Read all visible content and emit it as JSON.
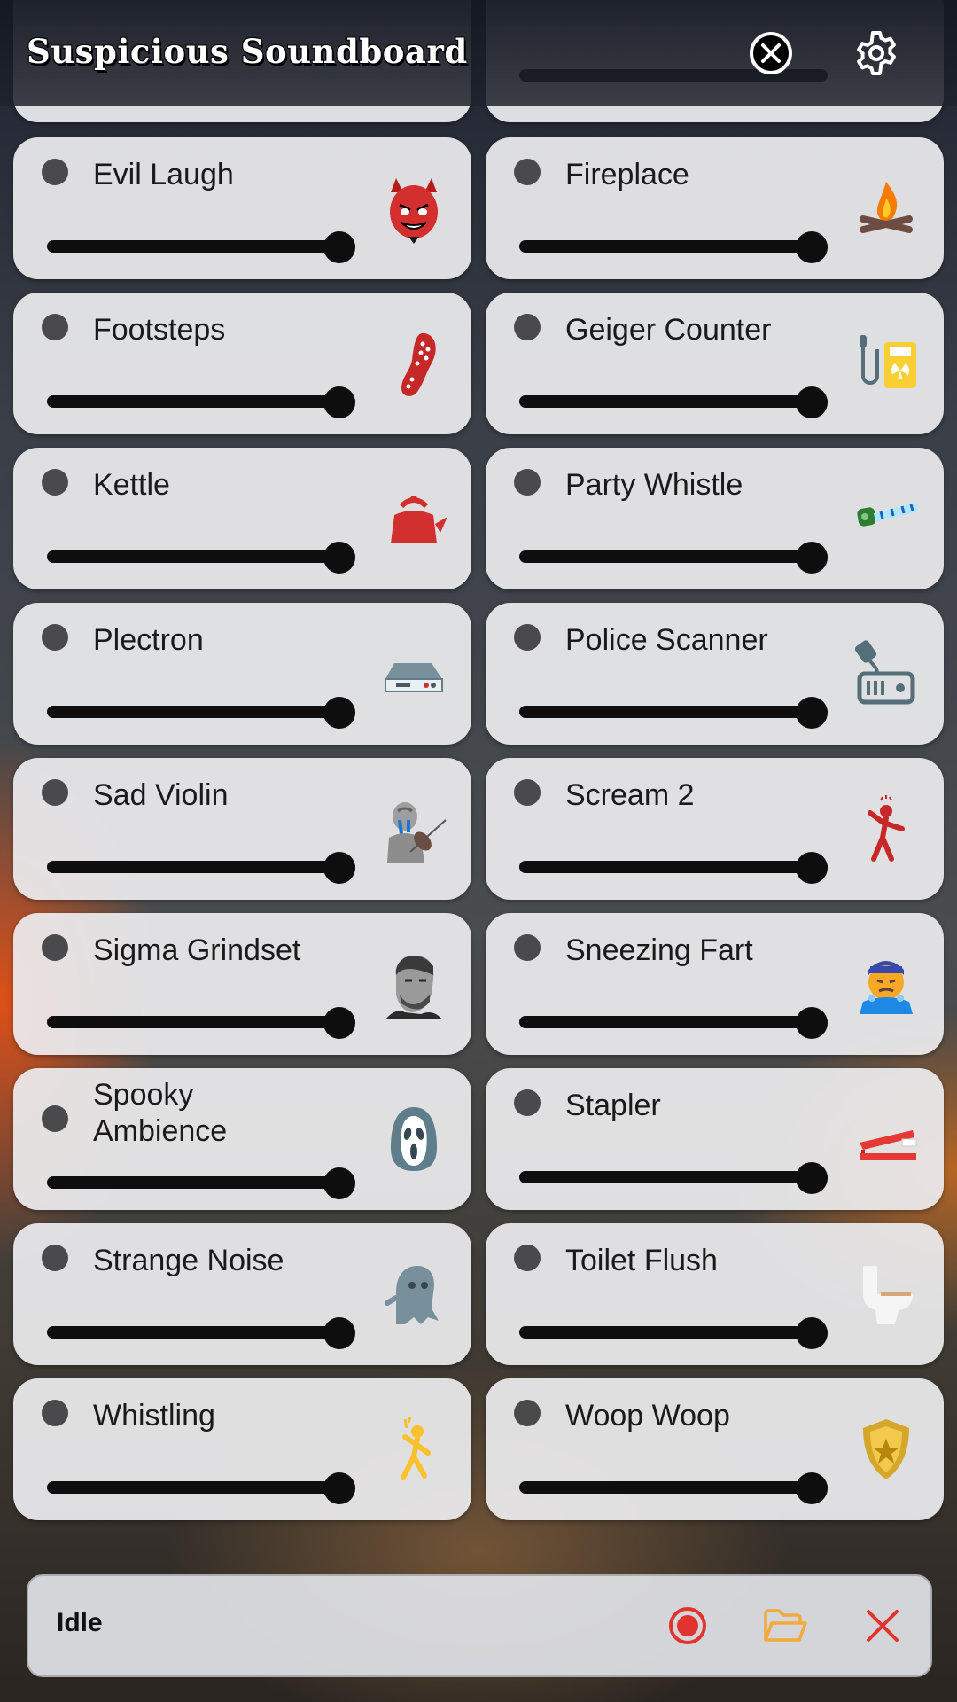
{
  "app": {
    "title": "Suspicious Soundboard",
    "close_icon": "close-circle-icon",
    "settings_icon": "gear-icon"
  },
  "sounds": [
    {
      "label": "Evil Laugh",
      "icon": "devil-icon",
      "volume": 1.0
    },
    {
      "label": "Fireplace",
      "icon": "campfire-icon",
      "volume": 1.0
    },
    {
      "label": "Footsteps",
      "icon": "shoe-sole-icon",
      "volume": 1.0
    },
    {
      "label": "Geiger Counter",
      "icon": "geiger-counter-icon",
      "volume": 1.0
    },
    {
      "label": "Kettle",
      "icon": "kettle-icon",
      "volume": 1.0
    },
    {
      "label": "Party Whistle",
      "icon": "party-blower-icon",
      "volume": 1.0
    },
    {
      "label": "Plectron",
      "icon": "radio-receiver-icon",
      "volume": 1.0
    },
    {
      "label": "Police Scanner",
      "icon": "police-scanner-icon",
      "volume": 1.0
    },
    {
      "label": "Sad Violin",
      "icon": "violinist-icon",
      "volume": 1.0
    },
    {
      "label": "Scream 2",
      "icon": "screaming-person-icon",
      "volume": 1.0
    },
    {
      "label": "Sigma Grindset",
      "icon": "chad-face-icon",
      "volume": 1.0
    },
    {
      "label": "Sneezing Fart",
      "icon": "sneezing-face-icon",
      "volume": 1.0
    },
    {
      "label": "Spooky Ambience",
      "icon": "ghostface-mask-icon",
      "volume": 1.0
    },
    {
      "label": "Stapler",
      "icon": "stapler-icon",
      "volume": 1.0
    },
    {
      "label": "Strange Noise",
      "icon": "ghost-icon",
      "volume": 1.0
    },
    {
      "label": "Toilet Flush",
      "icon": "toilet-icon",
      "volume": 1.0
    },
    {
      "label": "Whistling",
      "icon": "whistling-man-icon",
      "volume": 1.0
    },
    {
      "label": "Woop Woop",
      "icon": "police-badge-icon",
      "volume": 1.0
    }
  ],
  "footer": {
    "status": "Idle",
    "record_icon": "record-icon",
    "open_icon": "folder-open-icon",
    "clear_icon": "close-x-icon"
  },
  "colors": {
    "record": "#e2342f",
    "folder": "#f3a93b",
    "clear": "#e2342f"
  }
}
